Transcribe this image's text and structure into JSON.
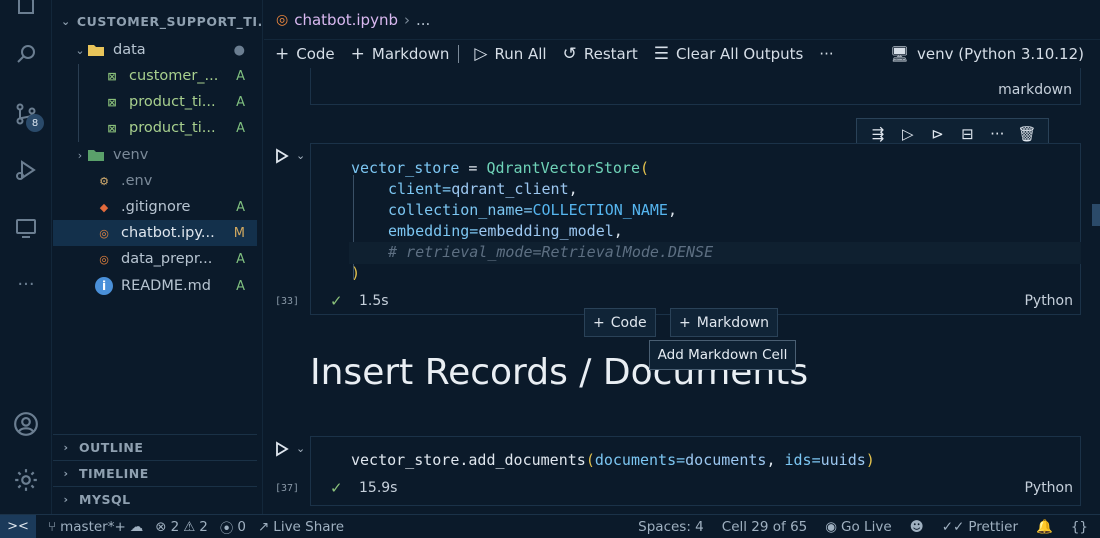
{
  "activity": {
    "scm_badge": "8"
  },
  "sidebar": {
    "title": "CUSTOMER_SUPPORT_TI...",
    "items": [
      {
        "name": "data",
        "type": "folder",
        "status": "●",
        "expanded": true
      },
      {
        "name": "customer_...",
        "type": "file",
        "status": "A"
      },
      {
        "name": "product_ti...",
        "type": "file",
        "status": "A"
      },
      {
        "name": "product_ti...",
        "type": "file",
        "status": "A"
      },
      {
        "name": "venv",
        "type": "folder",
        "status": "",
        "expanded": false
      },
      {
        "name": ".env",
        "type": "file",
        "status": ""
      },
      {
        "name": ".gitignore",
        "type": "file",
        "status": "A"
      },
      {
        "name": "chatbot.ipy...",
        "type": "file",
        "status": "M"
      },
      {
        "name": "data_prepr...",
        "type": "file",
        "status": "A"
      },
      {
        "name": "README.md",
        "type": "file",
        "status": "A"
      }
    ],
    "sections": [
      "OUTLINE",
      "TIMELINE",
      "MYSQL"
    ]
  },
  "editor": {
    "breadcrumb_file": "chatbot.ipynb",
    "breadcrumb_more": "...",
    "toolbar": {
      "code": "Code",
      "markdown": "Markdown",
      "run_all": "Run All",
      "restart": "Restart",
      "clear": "Clear All Outputs",
      "more": "···"
    },
    "kernel": "venv (Python 3.10.12)",
    "top_cell_lang": "markdown",
    "cell1": {
      "line1": {
        "var": "vector_store",
        "op": " = ",
        "cls": "QdrantVectorStore",
        "paren": "("
      },
      "line2": {
        "key": "client=",
        "val": "qdrant_client",
        "tail": ","
      },
      "line3": {
        "key": "collection_name=",
        "val": "COLLECTION_NAME",
        "tail": ","
      },
      "line4": {
        "key": "embedding=",
        "val": "embedding_model",
        "tail": ","
      },
      "line5": "# retrieval_mode=RetrievalMode.DENSE",
      "line6": ")",
      "exec_count": "[33]",
      "duration": "1.5s",
      "lang": "Python"
    },
    "add_code": "Code",
    "add_markdown": "Markdown",
    "tooltip": "Add Markdown Cell",
    "heading": "Insert Records / Documents",
    "cell2": {
      "pre": "vector_store.add_documents",
      "paren_open": "(",
      "args_key1": "documents=",
      "args_val1": "documents",
      "args_mid": ", ",
      "args_key2": "ids=",
      "args_val2": "uuids",
      "paren_close": ")",
      "exec_count": "[37]",
      "duration": "15.9s",
      "lang": "Python"
    }
  },
  "status": {
    "remote": "><",
    "branch": "master*+",
    "errors": "2",
    "warnings": "2",
    "ports": "0",
    "live_share": "Live Share",
    "spaces": "Spaces: 4",
    "cell": "Cell 29 of 65",
    "go_live": "Go Live",
    "prettier": "Prettier",
    "braces": "{}"
  }
}
